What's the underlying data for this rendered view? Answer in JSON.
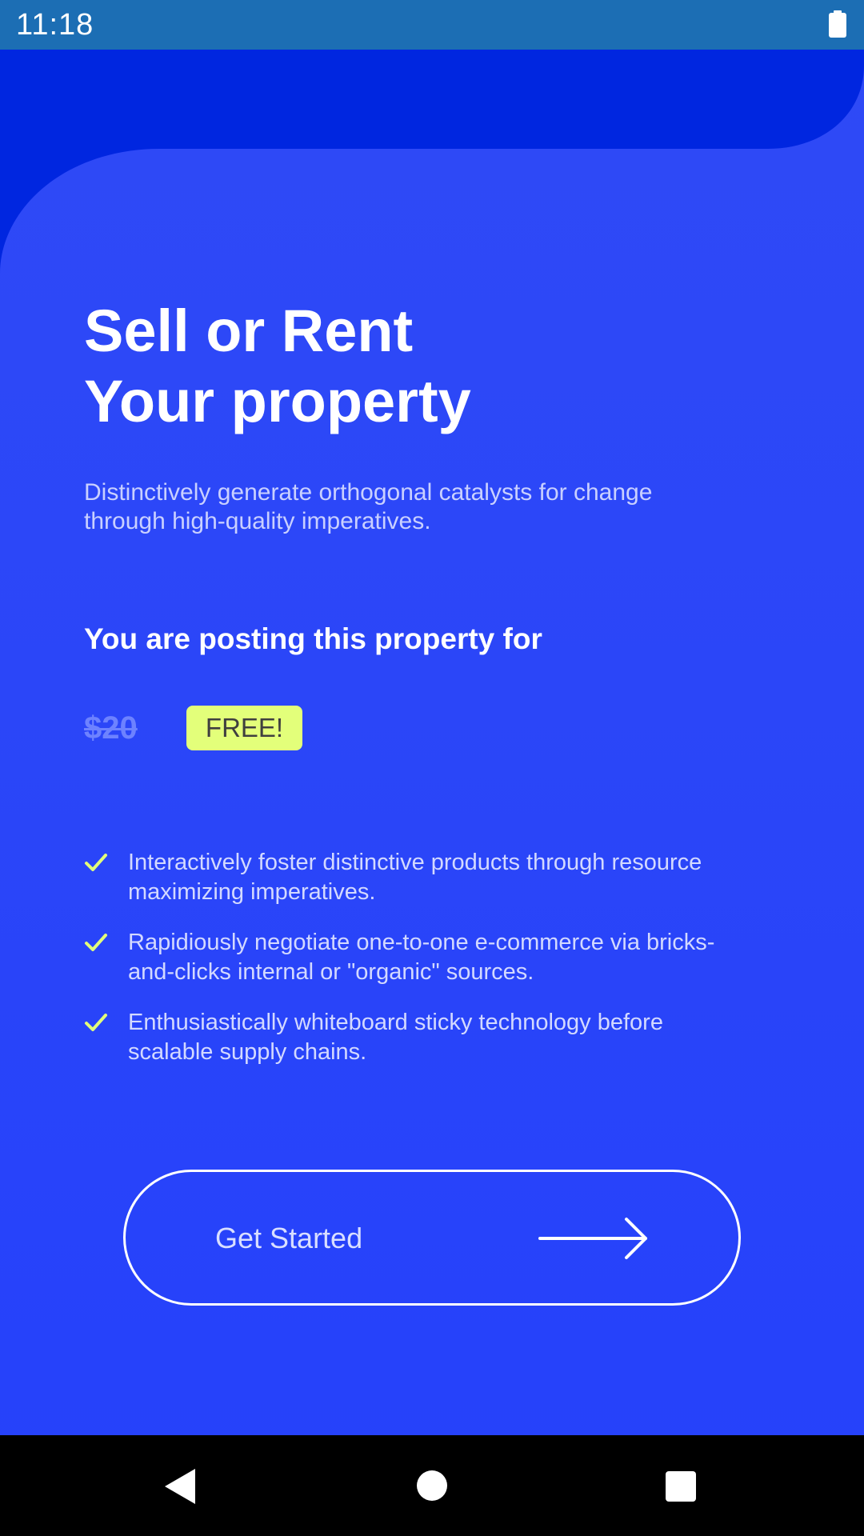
{
  "status_bar": {
    "time": "11:18",
    "battery_icon": "battery-full-icon"
  },
  "hero": {
    "headline_line1": "Sell or Rent",
    "headline_line2": "Your property",
    "subtitle": "Distinctively generate orthogonal catalysts for change through high-quality imperatives."
  },
  "pricing": {
    "posting_label": "You are posting this property for",
    "old_price": "$20",
    "badge": "FREE!"
  },
  "features": [
    {
      "text": "Interactively foster distinctive products through resource maximizing imperatives.",
      "icon": "check-icon"
    },
    {
      "text": "Rapidiously negotiate one-to-one e-commerce via bricks-and-clicks internal or \"organic\" sources.",
      "icon": "check-icon"
    },
    {
      "text": "Enthusiastically whiteboard sticky technology before scalable supply chains.",
      "icon": "check-icon"
    }
  ],
  "cta": {
    "label": "Get Started",
    "icon": "arrow-right-icon"
  },
  "nav_bar": {
    "back_icon": "back-triangle-icon",
    "home_icon": "home-circle-icon",
    "recents_icon": "recents-square-icon"
  },
  "colors": {
    "status_bar": "#1c6eb4",
    "background": "#2a45f8",
    "top_shape": "#0026e0",
    "accent": "#e3ff7a",
    "nav_bar": "#000000"
  }
}
